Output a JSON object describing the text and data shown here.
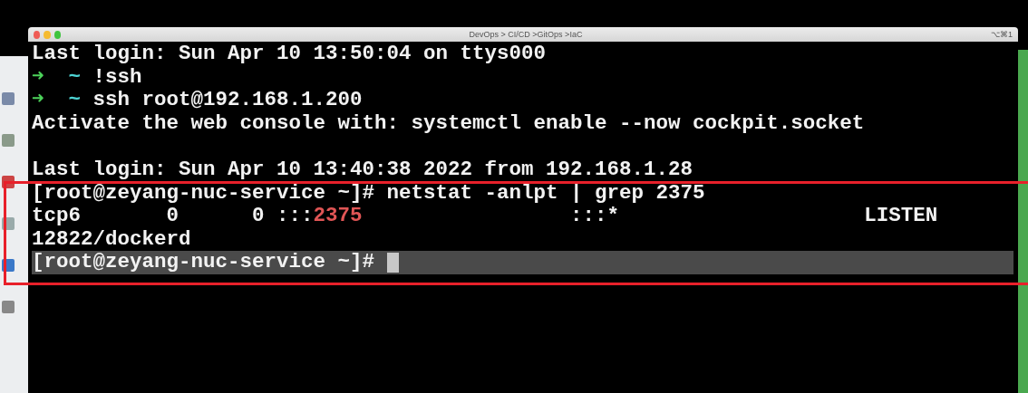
{
  "window": {
    "title": "DevOps > CI/CD >GitOps >IaC",
    "shortcut": "⌥⌘1"
  },
  "terminal": {
    "lines": [
      {
        "current": false,
        "segments": [
          {
            "kind": "plain",
            "text": "Last login: Sun Apr 10 13:50:04 on ttys000"
          }
        ]
      },
      {
        "current": false,
        "segments": [
          {
            "kind": "arrow",
            "text": "➜"
          },
          {
            "kind": "tilde",
            "text": "  ~"
          },
          {
            "kind": "plain",
            "text": " !ssh"
          }
        ]
      },
      {
        "current": false,
        "segments": [
          {
            "kind": "arrow",
            "text": "➜"
          },
          {
            "kind": "tilde",
            "text": "  ~"
          },
          {
            "kind": "plain",
            "text": " ssh root@192.168.1.200"
          }
        ]
      },
      {
        "current": false,
        "segments": [
          {
            "kind": "plain",
            "text": "Activate the web console with: systemctl enable --now cockpit.socket"
          }
        ]
      },
      {
        "gap_before": true,
        "current": false,
        "segments": [
          {
            "kind": "plain",
            "text": "Last login: Sun Apr 10 13:40:38 2022 from 192.168.1.28"
          }
        ]
      },
      {
        "current": false,
        "segments": [
          {
            "kind": "plain",
            "text": "[root@zeyang-nuc-service ~]# netstat -anlpt | grep 2375"
          }
        ]
      },
      {
        "current": false,
        "segments": [
          {
            "kind": "plain",
            "text": "tcp6       0      0 :::"
          },
          {
            "kind": "highlight",
            "text": "2375"
          },
          {
            "kind": "plain",
            "text": "                 :::*                    LISTEN"
          }
        ]
      },
      {
        "current": false,
        "segments": [
          {
            "kind": "plain",
            "text": "12822/dockerd"
          }
        ]
      },
      {
        "current": true,
        "cursor": true,
        "segments": [
          {
            "kind": "plain",
            "text": "[root@zeyang-nuc-service ~]# "
          }
        ]
      }
    ]
  }
}
